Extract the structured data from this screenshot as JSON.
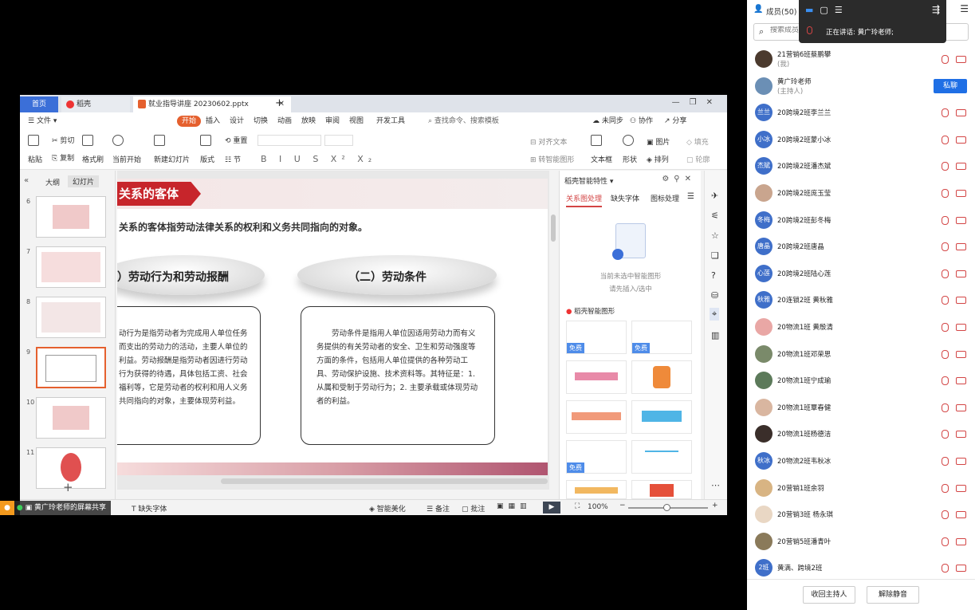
{
  "wps": {
    "tabs": {
      "home": "首页",
      "docer": "稻壳",
      "file": "就业指导讲座 20230602.pptx"
    },
    "menu": {
      "file": "文件",
      "start": "开始",
      "insert": "插入",
      "design": "设计",
      "switch": "切换",
      "animation": "动画",
      "show": "放映",
      "review": "审阅",
      "view": "视图",
      "dev": "开发工具",
      "search": "查找命令、搜索模板",
      "unsync": "未同步",
      "collab": "协作",
      "share": "分享"
    },
    "ribbon": {
      "paste": "粘贴",
      "cut": "剪切",
      "copy": "复制",
      "format_painter": "格式刷",
      "current_start": "当前开始",
      "new_slide": "新建幻灯片",
      "layout": "版式",
      "section": "节",
      "reset": "重置",
      "text_box": "文本框",
      "shape": "形状",
      "picture": "图片",
      "arrange": "排列",
      "fill": "填充",
      "outline": "轮廓",
      "align_text": "对齐文本",
      "smart_graphic": "转智能图形"
    },
    "thumbs": {
      "outline_tab": "大纲",
      "slides_tab": "幻灯片",
      "numbers": [
        "6",
        "7",
        "8",
        "9",
        "10",
        "11"
      ]
    },
    "slide": {
      "heading": "关系的客体",
      "intro": "关系的客体指劳动法律关系的权利和义务共同指向的对象。",
      "pill1": "）劳动行为和劳动报酬",
      "pill2": "（二）劳动条件",
      "box1": "动行为是指劳动者为完成用人单位任务而支出的劳动力的活动，主要人单位的利益。劳动报酬是指劳动者因进行劳动行为获得的待遇，具体包括工资、社会福利等，它是劳动者的权利和用人义务共同指向的对象，主要体现劳利益。",
      "box2": "劳动条件是指用人单位因适用劳动力而有义务提供的有关劳动者的安全、卫生和劳动强度等方面的条件，包括用人单位提供的各种劳动工具、劳动保护设施、技术资料等。其特征是：1. 从属和受制于劳动行为；2. 主要承载或体现劳动者的利益。"
    },
    "taskpane": {
      "title": "稻壳智能特性",
      "tab1": "关系图处理",
      "tab2": "缺失字体",
      "tab3": "图标处理",
      "empty1": "当前未选中智能图形",
      "empty2": "请先插入/选中",
      "section": "稻壳智能图形",
      "free": "免费"
    },
    "status": {
      "missing_font": "缺失字体",
      "smart_beautify": "智能美化",
      "notes": "备注",
      "comment": "批注",
      "zoom": "100%"
    }
  },
  "share": {
    "label": "黄广玲老师的屏幕共享"
  },
  "panel": {
    "title": "成员(50)",
    "search_placeholder": "搜索成员",
    "speaking": "正在讲话:  黄广玲老师;",
    "private_chat": "私聊",
    "members": [
      {
        "avatar": "",
        "name": "21营销6班蔡鹏攀",
        "role": "(我)",
        "color": "#4b3a2e"
      },
      {
        "avatar": "",
        "name": "黄广玲老师",
        "role": "(主持人)",
        "color": "#6b8fb5"
      },
      {
        "avatar": "兰兰",
        "name": "20跨境2班李兰兰",
        "color": "#3f6fc9"
      },
      {
        "avatar": "小冰",
        "name": "20跨境2班蒙小冰",
        "color": "#3f6fc9"
      },
      {
        "avatar": "杰斌",
        "name": "20跨境2班潘杰斌",
        "color": "#3f6fc9"
      },
      {
        "avatar": "",
        "name": "20跨境2班庞玉莹",
        "color": "#c9a58e"
      },
      {
        "avatar": "冬梅",
        "name": "20跨境2班彭冬梅",
        "color": "#3f6fc9"
      },
      {
        "avatar": "唐晶",
        "name": "20跨境2班唐晶",
        "color": "#3f6fc9"
      },
      {
        "avatar": "心莲",
        "name": "20跨境2班陆心莲",
        "color": "#3f6fc9"
      },
      {
        "avatar": "秋雅",
        "name": "20连锁2班 黄秋雅",
        "color": "#3f6fc9"
      },
      {
        "avatar": "",
        "name": "20物流1班  黄殷清",
        "color": "#e9a7a5"
      },
      {
        "avatar": "",
        "name": "20物流1班邓荣思",
        "color": "#7a8a6a"
      },
      {
        "avatar": "",
        "name": "20物流1班宁成瑜",
        "color": "#5c7a5a"
      },
      {
        "avatar": "",
        "name": "20物流1班覃春健",
        "color": "#d9b6a0"
      },
      {
        "avatar": "",
        "name": "20物流1班杨德洁",
        "color": "#3a2e2a"
      },
      {
        "avatar": "秋冰",
        "name": "20物流2班韦秋冰",
        "color": "#3f6fc9"
      },
      {
        "avatar": "",
        "name": "20营销1班余羽",
        "color": "#d8b483"
      },
      {
        "avatar": "",
        "name": "20营销3班 杨永琪",
        "color": "#e9d7c4"
      },
      {
        "avatar": "",
        "name": "20营销5班潘青叶",
        "color": "#8a7a5a"
      },
      {
        "avatar": "2班",
        "name": "黄满、跨境2班",
        "color": "#3f6fc9"
      }
    ],
    "revoke_host": "收回主持人",
    "unmute": "解除静音"
  }
}
